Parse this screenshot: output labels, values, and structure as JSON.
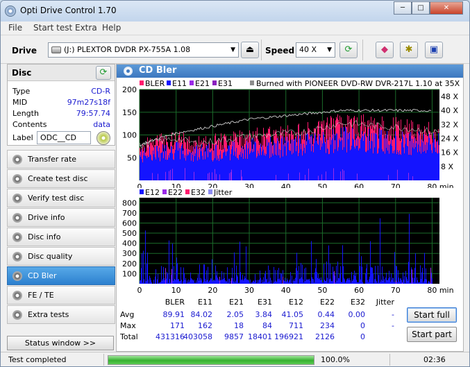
{
  "window": {
    "title": "Opti Drive Control 1.70",
    "buttons": [
      "─",
      "□",
      "✕"
    ]
  },
  "menu": [
    "File",
    "Start test",
    "Extra",
    "Help"
  ],
  "toolbar": {
    "drive_label": "Drive",
    "drive_value": "(J:)   PLEXTOR DVDR   PX-755A 1.08",
    "speed_label": "Speed",
    "speed_value": "40 X"
  },
  "icons": [
    "drive-icon",
    "eject-icon",
    "refresh-icon",
    "eraser-icon",
    "gear-icon",
    "save-icon"
  ],
  "disc": {
    "title": "Disc",
    "rows": [
      {
        "k": "Type",
        "v": "CD-R"
      },
      {
        "k": "MID",
        "v": "97m27s18f"
      },
      {
        "k": "Length",
        "v": "79:57.74"
      },
      {
        "k": "Contents",
        "v": "data"
      }
    ],
    "label_key": "Label",
    "label_value": "ODC__CD"
  },
  "nav": [
    {
      "label": "Transfer rate",
      "active": false
    },
    {
      "label": "Create test disc",
      "active": false
    },
    {
      "label": "Verify test disc",
      "active": false
    },
    {
      "label": "Drive info",
      "active": false
    },
    {
      "label": "Disc info",
      "active": false
    },
    {
      "label": "Disc quality",
      "active": false
    },
    {
      "label": "CD Bler",
      "active": true
    },
    {
      "label": "FE / TE",
      "active": false
    },
    {
      "label": "Extra tests",
      "active": false
    }
  ],
  "status_window_button": "Status window >>",
  "panel_title": "CD Bler",
  "chart_data": [
    {
      "type": "area",
      "legend": [
        {
          "name": "BLER",
          "color": "#ff1a6e"
        },
        {
          "name": "E11",
          "color": "#1414ff"
        },
        {
          "name": "E21",
          "color": "#9b2be8"
        },
        {
          "name": "E31",
          "color": "#8a1fbf"
        }
      ],
      "legend_note": "Burned with PIONEER DVD-RW  DVR-217L 1.10 at 35X",
      "note_color": "#8c8c8c",
      "x": [
        0,
        5,
        10,
        15,
        20,
        25,
        30,
        35,
        40,
        45,
        50,
        55,
        60,
        65,
        70,
        75,
        80
      ],
      "series": [
        {
          "name": "BLER",
          "values": [
            72,
            82,
            88,
            78,
            82,
            88,
            92,
            95,
            98,
            102,
            110,
            120,
            118,
            114,
            112,
            108,
            102
          ]
        },
        {
          "name": "E11",
          "values": [
            65,
            75,
            80,
            72,
            75,
            80,
            85,
            88,
            90,
            95,
            100,
            110,
            108,
            105,
            102,
            100,
            95
          ]
        }
      ],
      "speed_line": [
        20,
        24,
        27,
        29,
        31,
        33,
        35,
        36,
        37,
        38,
        39,
        40,
        40,
        40,
        40,
        40,
        40
      ],
      "xlabels": [
        "0",
        "10",
        "20",
        "30",
        "40",
        "50",
        "60",
        "70",
        "80 min"
      ],
      "ylabels": [
        "200",
        "150",
        "100",
        "50"
      ],
      "y2labels": [
        "48 X",
        "40 X",
        "32 X",
        "24 X",
        "16 X",
        "8 X"
      ],
      "xlim": [
        0,
        82
      ],
      "ylim": [
        0,
        200
      ],
      "y2lim": [
        0,
        52
      ]
    },
    {
      "type": "bar",
      "legend": [
        {
          "name": "E12",
          "color": "#1414ff"
        },
        {
          "name": "E22",
          "color": "#9b2be8"
        },
        {
          "name": "E32",
          "color": "#ff1a6e"
        },
        {
          "name": "Jitter",
          "color": "#8c8cf0"
        }
      ],
      "xlabels": [
        "0",
        "10",
        "20",
        "30",
        "40",
        "50",
        "60",
        "70",
        "80 min"
      ],
      "ylabels": [
        "800",
        "700",
        "600",
        "500",
        "400",
        "300",
        "200",
        "100"
      ],
      "xlim": [
        0,
        82
      ],
      "ylim": [
        0,
        850
      ],
      "e12_avg": 41.05,
      "e12_max": 711
    }
  ],
  "stats": {
    "cols": [
      "",
      "BLER",
      "E11",
      "E21",
      "E31",
      "E12",
      "E22",
      "E32",
      "Jitter"
    ],
    "rows": [
      {
        "name": "Avg",
        "values": [
          "89.91",
          "84.02",
          "2.05",
          "3.84",
          "41.05",
          "0.44",
          "0.00",
          "-"
        ]
      },
      {
        "name": "Max",
        "values": [
          "171",
          "162",
          "18",
          "84",
          "711",
          "234",
          "0",
          "-"
        ]
      },
      {
        "name": "Total",
        "values": [
          "431316",
          "403058",
          "9857",
          "18401",
          "196921",
          "2126",
          "0",
          ""
        ]
      }
    ]
  },
  "actions": {
    "start_full": "Start full",
    "start_part": "Start part"
  },
  "status": {
    "text": "Test completed",
    "percent": "100.0%",
    "progress": 1.0,
    "time": "02:36"
  }
}
